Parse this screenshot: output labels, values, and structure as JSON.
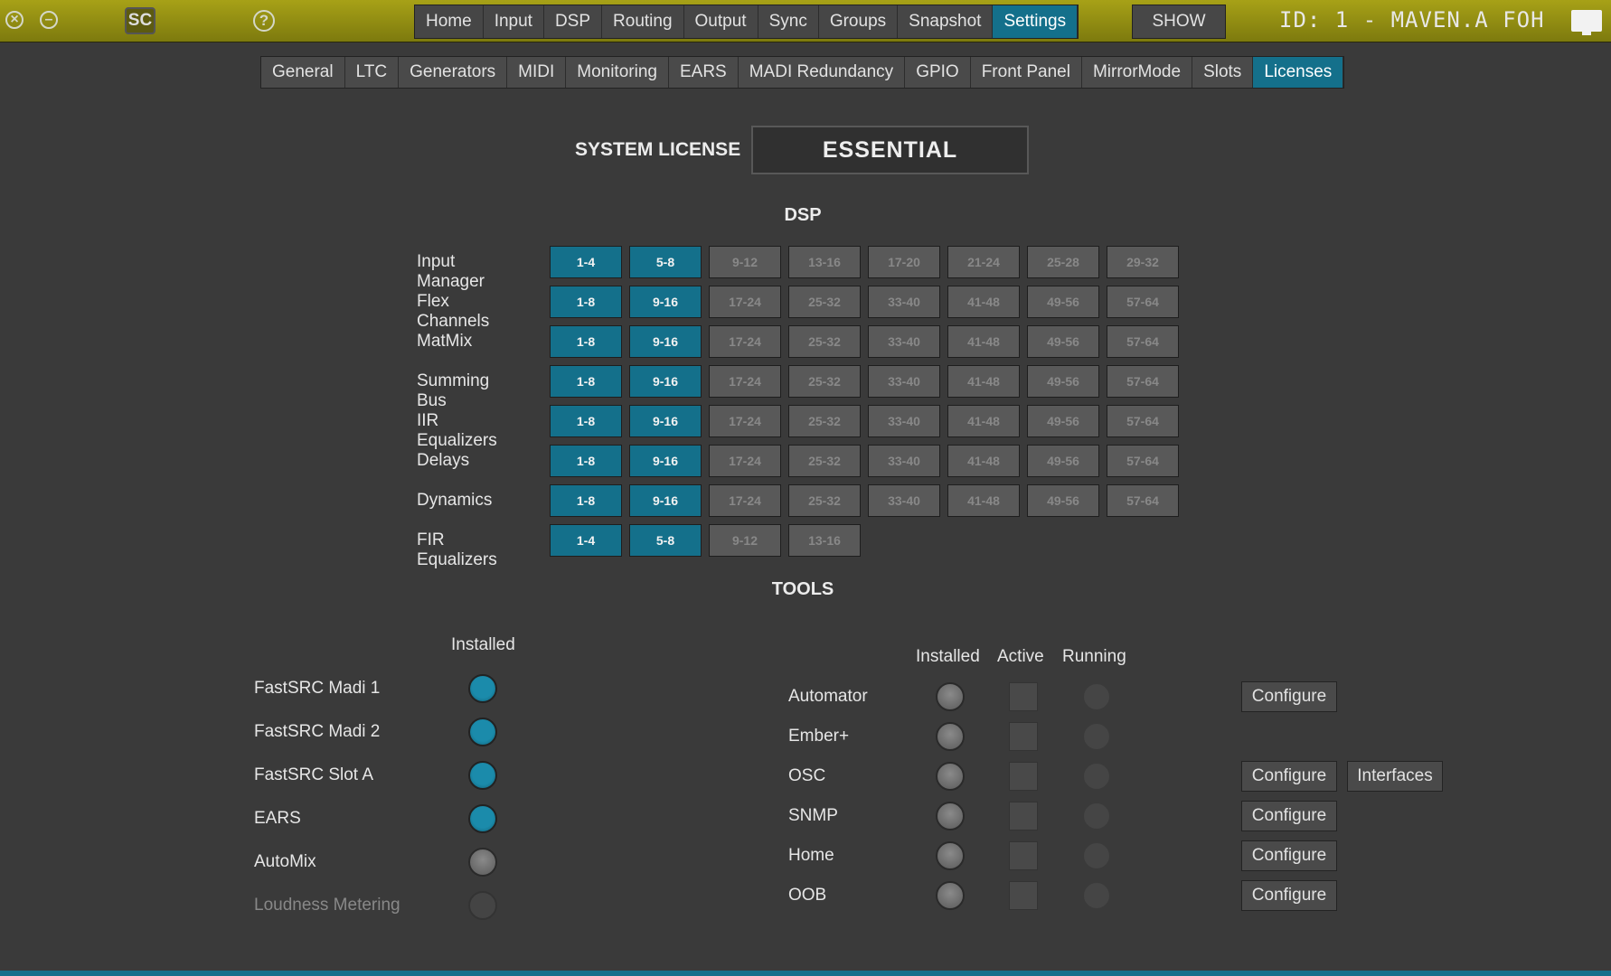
{
  "topbar": {
    "sc_label": "SC",
    "help_label": "?",
    "nav": [
      "Home",
      "Input",
      "DSP",
      "Routing",
      "Output",
      "Sync",
      "Groups",
      "Snapshot",
      "Settings"
    ],
    "nav_active": "Settings",
    "show_label": "SHOW",
    "device_id": "ID: 1 - MAVEN.A FOH"
  },
  "subnav": {
    "items": [
      "General",
      "LTC",
      "Generators",
      "MIDI",
      "Monitoring",
      "EARS",
      "MADI Redundancy",
      "GPIO",
      "Front Panel",
      "MirrorMode",
      "Slots",
      "Licenses"
    ],
    "active": "Licenses"
  },
  "license": {
    "label": "SYSTEM LICENSE",
    "value": "ESSENTIAL"
  },
  "dsp": {
    "title": "DSP",
    "rows": [
      {
        "name": "Input Manager",
        "cells": [
          "1-4",
          "5-8",
          "9-12",
          "13-16",
          "17-20",
          "21-24",
          "25-28",
          "29-32"
        ],
        "active": 2
      },
      {
        "name": "Flex Channels",
        "cells": [
          "1-8",
          "9-16",
          "17-24",
          "25-32",
          "33-40",
          "41-48",
          "49-56",
          "57-64"
        ],
        "active": 2
      },
      {
        "name": "MatMix",
        "cells": [
          "1-8",
          "9-16",
          "17-24",
          "25-32",
          "33-40",
          "41-48",
          "49-56",
          "57-64"
        ],
        "active": 2
      },
      {
        "name": "Summing Bus",
        "cells": [
          "1-8",
          "9-16",
          "17-24",
          "25-32",
          "33-40",
          "41-48",
          "49-56",
          "57-64"
        ],
        "active": 2
      },
      {
        "name": "IIR Equalizers",
        "cells": [
          "1-8",
          "9-16",
          "17-24",
          "25-32",
          "33-40",
          "41-48",
          "49-56",
          "57-64"
        ],
        "active": 2
      },
      {
        "name": "Delays",
        "cells": [
          "1-8",
          "9-16",
          "17-24",
          "25-32",
          "33-40",
          "41-48",
          "49-56",
          "57-64"
        ],
        "active": 2
      },
      {
        "name": "Dynamics",
        "cells": [
          "1-8",
          "9-16",
          "17-24",
          "25-32",
          "33-40",
          "41-48",
          "49-56",
          "57-64"
        ],
        "active": 2
      },
      {
        "name": "FIR Equalizers",
        "cells": [
          "1-4",
          "5-8",
          "9-12",
          "13-16"
        ],
        "active": 2
      }
    ]
  },
  "tools": {
    "title": "TOOLS",
    "left_header": "Installed",
    "left_items": [
      {
        "name": "FastSRC Madi 1",
        "state": "blue"
      },
      {
        "name": "FastSRC Madi 2",
        "state": "blue"
      },
      {
        "name": "FastSRC Slot A",
        "state": "blue"
      },
      {
        "name": "EARS",
        "state": "blue"
      },
      {
        "name": "AutoMix",
        "state": "grey"
      },
      {
        "name": "Loudness Metering",
        "state": "dim"
      }
    ],
    "right_headers": [
      "Installed",
      "Active",
      "Running"
    ],
    "right_items": [
      {
        "name": "Automator",
        "buttons": [
          "Configure"
        ]
      },
      {
        "name": "Ember+",
        "buttons": []
      },
      {
        "name": "OSC",
        "buttons": [
          "Configure",
          "Interfaces"
        ]
      },
      {
        "name": "SNMP",
        "buttons": [
          "Configure"
        ]
      },
      {
        "name": "Home",
        "buttons": [
          "Configure"
        ]
      },
      {
        "name": "OOB",
        "buttons": [
          "Configure"
        ]
      }
    ]
  },
  "colors": {
    "accent": "#14708b",
    "topbar": "#9a9414",
    "background": "#3a3a3a"
  }
}
